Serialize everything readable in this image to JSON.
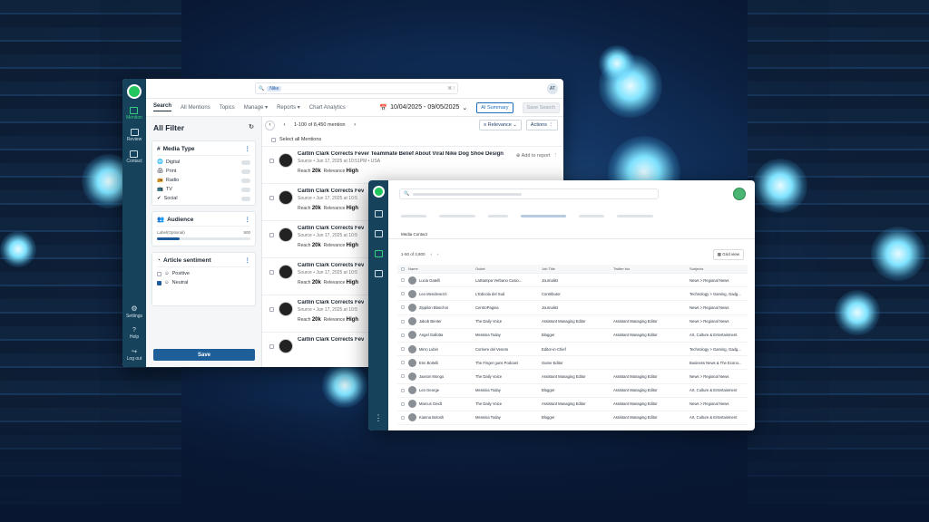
{
  "left_window": {
    "rail": [
      {
        "label": "Mention",
        "icon": "mention-icon",
        "active": true
      },
      {
        "label": "Review",
        "icon": "review-icon"
      },
      {
        "label": "Contact",
        "icon": "contact-icon"
      },
      {
        "label": "Settings",
        "icon": "gear-icon"
      },
      {
        "label": "Help",
        "icon": "help-icon"
      },
      {
        "label": "Log out",
        "icon": "logout-icon"
      }
    ],
    "search": {
      "chip": "Nike",
      "shortcut": "⌘ /"
    },
    "avatar_initials": "AT",
    "tabs": [
      "Search",
      "All Mentions",
      "Topics",
      "Manage ▾",
      "Reports ▾",
      "Chart Analytics"
    ],
    "date_range": "10/04/2025 - 09/05/2025",
    "ai_summary": "AI Summary",
    "save_search": "Save Search",
    "filter": {
      "title": "All Filter",
      "media_type": {
        "title": "Media Type",
        "items": [
          "Digital",
          "Print",
          "Radio",
          "TV",
          "Social"
        ]
      },
      "audience": {
        "title": "Audience",
        "label": "Label(Optional)",
        "max": "500",
        "level_percent": 24
      },
      "sentiment": {
        "title": "Article sentiment",
        "items": [
          "Positive",
          "Neutral"
        ]
      },
      "save": "Save"
    },
    "results": {
      "count": "1-100 of 8,450 mention",
      "sort": "Relevance",
      "actions": "Actions",
      "select_all": "Select all Mentions",
      "add_to_report": "Add to report",
      "items": [
        {
          "title": "Caitlin Clark Corrects Fever Teammate Belief About Viral Nike Dog Shoe Design",
          "meta": "Source • Jun 17, 2025 at 10:51PM • USA",
          "reach": "20k",
          "relevance": "High"
        },
        {
          "title": "Caitlin Clark Corrects Fev",
          "meta": "Source • Jun 17, 2025 at 10:5",
          "reach": "20k",
          "relevance": "High"
        },
        {
          "title": "Caitlin Clark Corrects Fev",
          "meta": "Source • Jun 17, 2025 at 10:5",
          "reach": "20k",
          "relevance": "High"
        },
        {
          "title": "Caitlin Clark Corrects Fev",
          "meta": "Source • Jun 17, 2025 at 10:5",
          "reach": "20k",
          "relevance": "High"
        },
        {
          "title": "Caitlin Clark Corrects Fev",
          "meta": "Source • Jun 17, 2025 at 10:5",
          "reach": "20k",
          "relevance": "High"
        },
        {
          "title": "Caitlin Clark Corrects Fev",
          "meta": "",
          "reach": "",
          "relevance": ""
        }
      ]
    }
  },
  "right_window": {
    "breadcrumb": "Media Contact",
    "count": "1-50 of 3,800",
    "grid_view": "Grid view",
    "columns": [
      "Name",
      "Outlet",
      "Job Title",
      "Twitter bio",
      "Subjects"
    ],
    "rows": [
      [
        "Lucia Gatelli",
        "LaStampa Verbano Cusio...",
        "Journalist",
        "",
        "News > Regional News"
      ],
      [
        "Leo Mendevezzi",
        "L'Edicola del Sud",
        "Contributor",
        "",
        "Technology > Gaming, Gadg..."
      ],
      [
        "Zippilon Blanchor",
        "CentroPagina",
        "Journalist",
        "",
        "News > Regional News"
      ],
      [
        "Jakob Benter",
        "The Daily Voice",
        "Assistant Managing Editor",
        "Assistant Managing Editor",
        "News > Regional News"
      ],
      [
        "Angel Gallotta",
        "Messina Today",
        "Blogger",
        "Assistant Managing Editor",
        "Art, Culture & Entertainment"
      ],
      [
        "Mirro Lubin",
        "Corriere del Veneto",
        "Editor-in-Chief",
        "",
        "Technology > Gaming, Gadg..."
      ],
      [
        "Erin Boitelli",
        "The Finger guns Podcast",
        "Game Editor",
        "",
        "Business News & The Econo..."
      ],
      [
        "Jaxson Mongo",
        "The Daily Voice",
        "Assistant Managing Editor",
        "Assistant Managing Editor",
        "News > Regional News"
      ],
      [
        "Leo George",
        "Messina Today",
        "Blogger",
        "Assistant Managing Editor",
        "Art, Culture & Entertainment"
      ],
      [
        "Marcus Geidt",
        "The Daily Voice",
        "Assistant Managing Editor",
        "Assistant Managing Editor",
        "News > Regional News"
      ],
      [
        "Kianna Botosh",
        "Messina Today",
        "Blogger",
        "Assistant Managing Editor",
        "Art, Culture & Entertainment"
      ]
    ]
  },
  "colors": {
    "rail": "#16425b",
    "accent": "#1e5e99",
    "brand_green": "#23c55e"
  }
}
